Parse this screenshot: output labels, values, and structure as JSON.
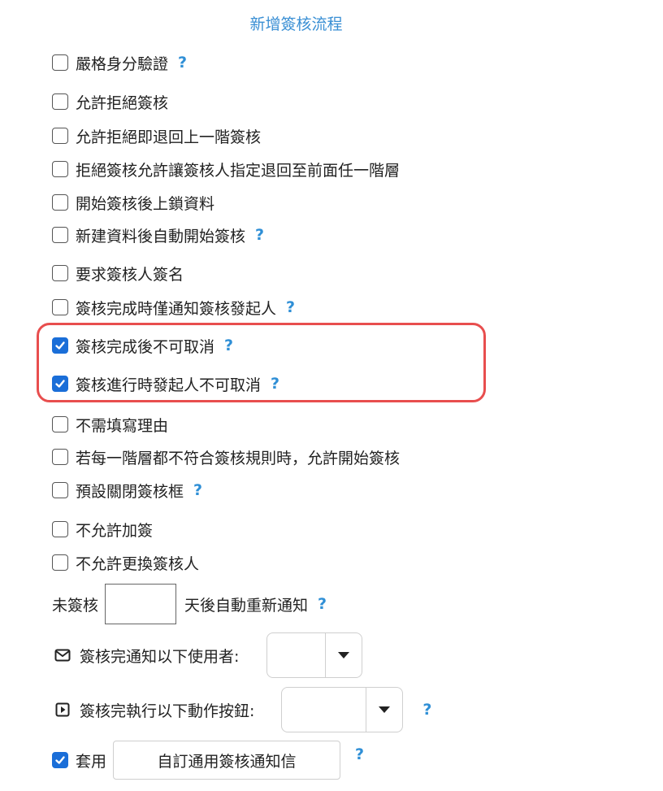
{
  "title": "新增簽核流程",
  "help_glyph": "?",
  "options": [
    {
      "label": "嚴格身分驗證",
      "checked": false,
      "help": true
    },
    {
      "label": "允許拒絕簽核",
      "checked": false,
      "help": false
    },
    {
      "label": "允許拒絕即退回上一階簽核",
      "checked": false,
      "help": false
    },
    {
      "label": "拒絕簽核允許讓簽核人指定退回至前面任一階層",
      "checked": false,
      "help": false
    },
    {
      "label": "開始簽核後上鎖資料",
      "checked": false,
      "help": false
    },
    {
      "label": "新建資料後自動開始簽核",
      "checked": false,
      "help": true
    },
    {
      "label": "要求簽核人簽名",
      "checked": false,
      "help": false
    },
    {
      "label": "簽核完成時僅通知簽核發起人",
      "checked": false,
      "help": true
    },
    {
      "label": "簽核完成後不可取消",
      "checked": true,
      "help": true
    },
    {
      "label": "簽核進行時發起人不可取消",
      "checked": true,
      "help": true
    },
    {
      "label": "不需填寫理由",
      "checked": false,
      "help": false
    },
    {
      "label": "若每一階層都不符合簽核規則時，允許開始簽核",
      "checked": false,
      "help": false
    },
    {
      "label": "預設關閉簽核框",
      "checked": false,
      "help": true
    },
    {
      "label": "不允許加簽",
      "checked": false,
      "help": false
    },
    {
      "label": "不允許更換簽核人",
      "checked": false,
      "help": false
    }
  ],
  "reminder": {
    "prefix": "未簽核",
    "days_value": "",
    "suffix": "天後自動重新通知"
  },
  "notify": {
    "label": "簽核完通知以下使用者:",
    "selected": ""
  },
  "action": {
    "label": "簽核完執行以下動作按鈕:",
    "selected": ""
  },
  "apply": {
    "checked": true,
    "label": "套用",
    "button_label": "自訂通用簽核通知信"
  },
  "colors": {
    "accent": "#1a6ed8",
    "help": "#2f8fd6",
    "title": "#3a8fd4",
    "highlight": "#e84e4e"
  }
}
